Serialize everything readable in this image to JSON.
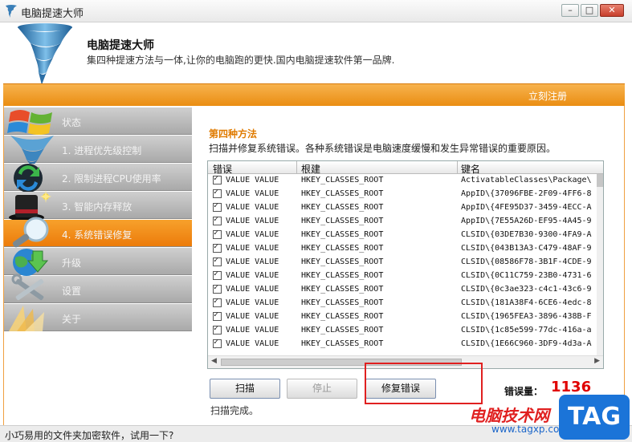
{
  "window": {
    "title": "电脑提速大师",
    "min_label": "–",
    "max_label": "□",
    "close_label": "✕"
  },
  "header": {
    "app_name": "电脑提速大师",
    "slogan": "集四种提速方法与一体,让你的电脑跑的更快.国内电脑提速软件第一品牌."
  },
  "topbar": {
    "register_label": "立刻注册"
  },
  "sidebar": {
    "items": [
      {
        "label": "状态",
        "icon": "windows-logo-icon",
        "active": false
      },
      {
        "label": "1. 进程优先级控制",
        "icon": "tornado-icon",
        "active": false
      },
      {
        "label": "2. 限制进程CPU使用率",
        "icon": "recycle-arrows-icon",
        "active": false
      },
      {
        "label": "3. 智能内存释放",
        "icon": "magic-hat-icon",
        "active": false
      },
      {
        "label": "4. 系统错误修复",
        "icon": "magnifier-icon",
        "active": true
      },
      {
        "label": "升级",
        "icon": "globe-download-icon",
        "active": false
      },
      {
        "label": "设置",
        "icon": "tools-icon",
        "active": false
      },
      {
        "label": "关于",
        "icon": "light-rays-icon",
        "active": false
      }
    ]
  },
  "main": {
    "section_title": "第四种方法",
    "section_desc": "扫描并修复系统错误。各种系统错误是电脑速度缓慢和发生异常错误的重要原因。",
    "columns": [
      "错误",
      "根建",
      "键名"
    ],
    "rows": [
      {
        "checked": true,
        "error": "VALUE VALUE",
        "root": "HKEY_CLASSES_ROOT",
        "key": "ActivatableClasses\\Package\\"
      },
      {
        "checked": true,
        "error": "VALUE VALUE",
        "root": "HKEY_CLASSES_ROOT",
        "key": "AppID\\{37096FBE-2F09-4FF6-8"
      },
      {
        "checked": true,
        "error": "VALUE VALUE",
        "root": "HKEY_CLASSES_ROOT",
        "key": "AppID\\{4FE95D37-3459-4ECC-A"
      },
      {
        "checked": true,
        "error": "VALUE VALUE",
        "root": "HKEY_CLASSES_ROOT",
        "key": "AppID\\{7E55A26D-EF95-4A45-9"
      },
      {
        "checked": true,
        "error": "VALUE VALUE",
        "root": "HKEY_CLASSES_ROOT",
        "key": "CLSID\\{03DE7B30-9300-4FA9-A"
      },
      {
        "checked": true,
        "error": "VALUE VALUE",
        "root": "HKEY_CLASSES_ROOT",
        "key": "CLSID\\{043B13A3-C479-48AF-9"
      },
      {
        "checked": true,
        "error": "VALUE VALUE",
        "root": "HKEY_CLASSES_ROOT",
        "key": "CLSID\\{08586F78-3B1F-4CDE-9"
      },
      {
        "checked": true,
        "error": "VALUE VALUE",
        "root": "HKEY_CLASSES_ROOT",
        "key": "CLSID\\{0C11C759-23B0-4731-6"
      },
      {
        "checked": true,
        "error": "VALUE VALUE",
        "root": "HKEY_CLASSES_ROOT",
        "key": "CLSID\\{0c3ae323-c4c1-43c6-9"
      },
      {
        "checked": true,
        "error": "VALUE VALUE",
        "root": "HKEY_CLASSES_ROOT",
        "key": "CLSID\\{181A38F4-6CE6-4edc-8"
      },
      {
        "checked": true,
        "error": "VALUE VALUE",
        "root": "HKEY_CLASSES_ROOT",
        "key": "CLSID\\{1965FEA3-3896-438B-F"
      },
      {
        "checked": true,
        "error": "VALUE VALUE",
        "root": "HKEY_CLASSES_ROOT",
        "key": "CLSID\\{1c85e599-77dc-416a-a"
      },
      {
        "checked": true,
        "error": "VALUE VALUE",
        "root": "HKEY_CLASSES_ROOT",
        "key": "CLSID\\{1E66C960-3DF9-4d3a-A"
      }
    ],
    "buttons": {
      "scan": "扫描",
      "stop": "停止",
      "repair": "修复错误"
    },
    "error_label": "错误量：",
    "error_count": "1136",
    "status": "扫描完成。"
  },
  "statusbar": {
    "promo": "小巧易用的文件夹加密软件，试用一下?"
  },
  "watermark": {
    "site_name": "电脑技术网",
    "url": "www.tagxp.com",
    "tag": "TAG"
  }
}
